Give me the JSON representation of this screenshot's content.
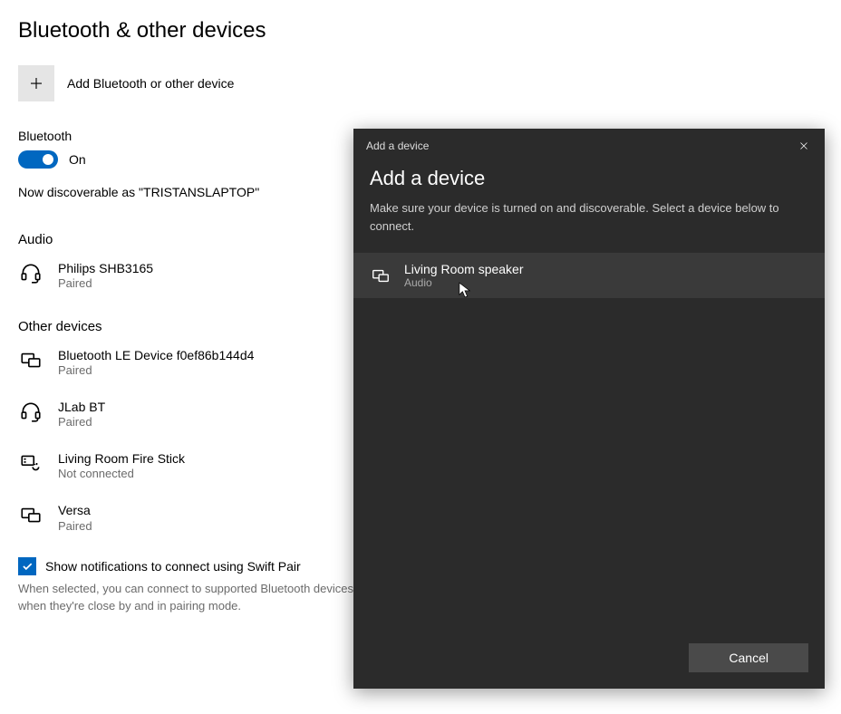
{
  "page": {
    "title": "Bluetooth & other devices"
  },
  "add_device": {
    "label": "Add Bluetooth or other device"
  },
  "bluetooth": {
    "label": "Bluetooth",
    "state": "On",
    "discoverable_text": "Now discoverable as \"TRISTANSLAPTOP\""
  },
  "audio": {
    "header": "Audio",
    "devices": [
      {
        "name": "Philips SHB3165",
        "status": "Paired"
      }
    ]
  },
  "other": {
    "header": "Other devices",
    "devices": [
      {
        "name": "Bluetooth LE Device f0ef86b144d4",
        "status": "Paired"
      },
      {
        "name": "JLab BT",
        "status": "Paired"
      },
      {
        "name": "Living Room Fire Stick",
        "status": "Not connected"
      },
      {
        "name": "Versa",
        "status": "Paired"
      }
    ]
  },
  "swift_pair": {
    "label": "Show notifications to connect using Swift Pair",
    "description": "When selected, you can connect to supported Bluetooth devices quickly when they're close by and in pairing mode."
  },
  "dialog": {
    "titlebar": "Add a device",
    "heading": "Add a device",
    "description": "Make sure your device is turned on and discoverable. Select a device below to connect.",
    "found": {
      "name": "Living Room speaker",
      "type": "Audio"
    },
    "cancel": "Cancel"
  }
}
